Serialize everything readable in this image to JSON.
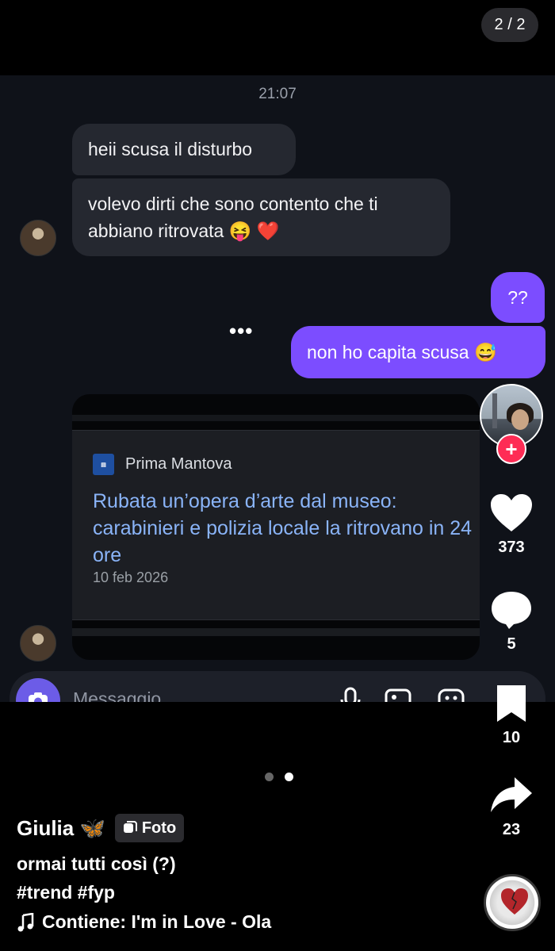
{
  "page_counter": "2 / 2",
  "chat": {
    "timestamp": "21:07",
    "messages": [
      {
        "text": "heii scusa il disturbo"
      },
      {
        "text": "volevo dirti che sono contento che ti abbiano ritrovata 😝 ❤️"
      },
      {
        "text": "??"
      },
      {
        "text": "non ho capita scusa 😅"
      }
    ],
    "typing": "•••",
    "shared_card": {
      "source": "Prima Mantova",
      "headline": "Rubata un’opera d’arte dal museo: carabinieri e polizia locale la ritrovano in 24 ore",
      "date": "10 feb 2026"
    },
    "composer_placeholder": "Messaggio"
  },
  "actions": {
    "likes": "373",
    "comments": "5",
    "saves": "10",
    "shares": "23"
  },
  "post": {
    "author": "Giulia 🦋",
    "type_badge": "Foto",
    "caption_line1": "ormai tutti così (?)",
    "caption_line2": "#trend #fyp",
    "music": "Contiene: I'm in Love - Ola"
  },
  "colors": {
    "outgoing_bubble": "#7c4dff",
    "incoming_bubble": "#252830",
    "follow_red": "#fe2c55",
    "link_blue": "#8ab4f8"
  }
}
